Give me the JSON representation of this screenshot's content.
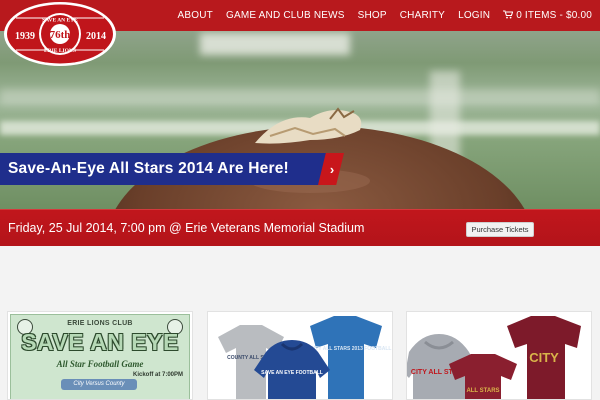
{
  "logo": {
    "year_left": "1939",
    "year_right": "2014",
    "edition": "76th",
    "name_top": "SAVE AN EYE",
    "name_bottom": "ERIE LIONS"
  },
  "nav": {
    "items": [
      "ABOUT",
      "GAME AND CLUB NEWS",
      "SHOP",
      "CHARITY",
      "LOGIN"
    ],
    "cart": "0 ITEMS - $0.00",
    "cart_icon": "cart-icon"
  },
  "hero": {
    "caption": "Save-An-Eye All Stars 2014 Are Here!",
    "arrow_icon": "chevron-right-icon",
    "slides": 3,
    "active_slide": 1
  },
  "event": {
    "text": "Friday, 25 Jul 2014, 7:00 pm @ Erie Veterans Memorial Stadium",
    "button": "Purchase Tickets"
  },
  "products": {
    "poster": {
      "club": "ERIE LIONS CLUB",
      "title": "SAVE AN EYE",
      "subtitle": "All Star Football Game",
      "kickoff": "Kickoff at 7:00PM",
      "band": "City Versus County"
    },
    "apparel_county": {
      "shirt_text": "COUNTY ALL STARS",
      "hoodie_text": "SAVE AN EYE FOOTBALL",
      "tee_text": "COUNTY ALL STARS 2013 FOOTBALL"
    },
    "apparel_city": {
      "hoodie_text": "CITY ALL STARS",
      "tee_text": "CITY",
      "tee2_text": "ALL STARS"
    }
  },
  "colors": {
    "brand_red": "#b8191d",
    "caption_blue": "#1f2e8c"
  }
}
